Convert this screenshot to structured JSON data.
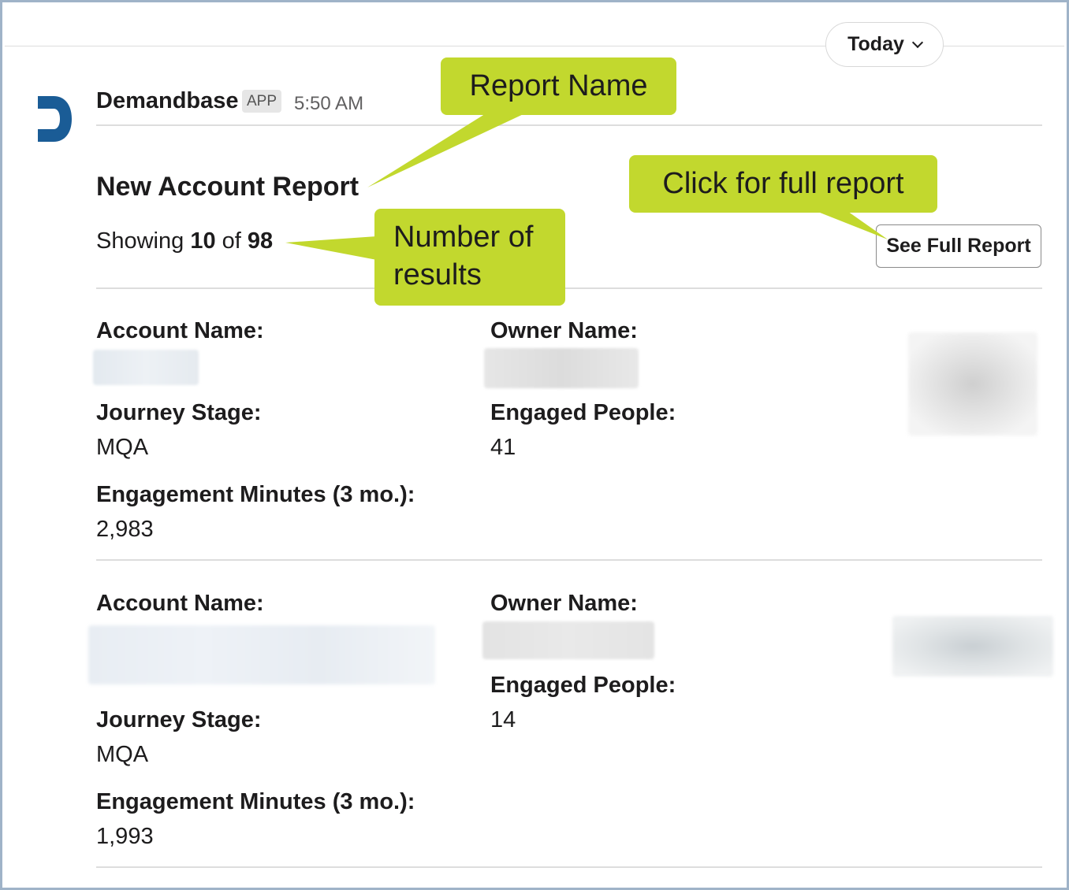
{
  "date_filter": {
    "label": "Today",
    "icon": "chevron-down-icon"
  },
  "message": {
    "sender": "Demandbase",
    "badge": "APP",
    "time": "5:50 AM",
    "logo_icon": "demandbase-logo-icon",
    "report_title": "New Account Report",
    "showing": {
      "prefix": "Showing",
      "count": "10",
      "of": "of",
      "total": "98"
    },
    "full_report_button": "See Full Report"
  },
  "records": [
    {
      "account_label": "Account Name:",
      "owner_label": "Owner Name:",
      "journey_label": "Journey Stage:",
      "journey_value": "MQA",
      "engaged_label": "Engaged People:",
      "engaged_value": "41",
      "minutes_label": "Engagement Minutes (3 mo.):",
      "minutes_value": "2,983"
    },
    {
      "account_label": "Account Name:",
      "owner_label": "Owner Name:",
      "journey_label": "Journey Stage:",
      "journey_value": "MQA",
      "engaged_label": "Engaged People:",
      "engaged_value": "14",
      "minutes_label": "Engagement Minutes (3 mo.):",
      "minutes_value": "1,993"
    }
  ],
  "annotations": {
    "report_name": "Report Name",
    "number_of_results_line1": "Number of",
    "number_of_results_line2": "results",
    "click_full_report": "Click for full report"
  },
  "colors": {
    "callout": "#c2d82e",
    "logo": "#1a5c96",
    "frame": "#9fb3c8"
  }
}
